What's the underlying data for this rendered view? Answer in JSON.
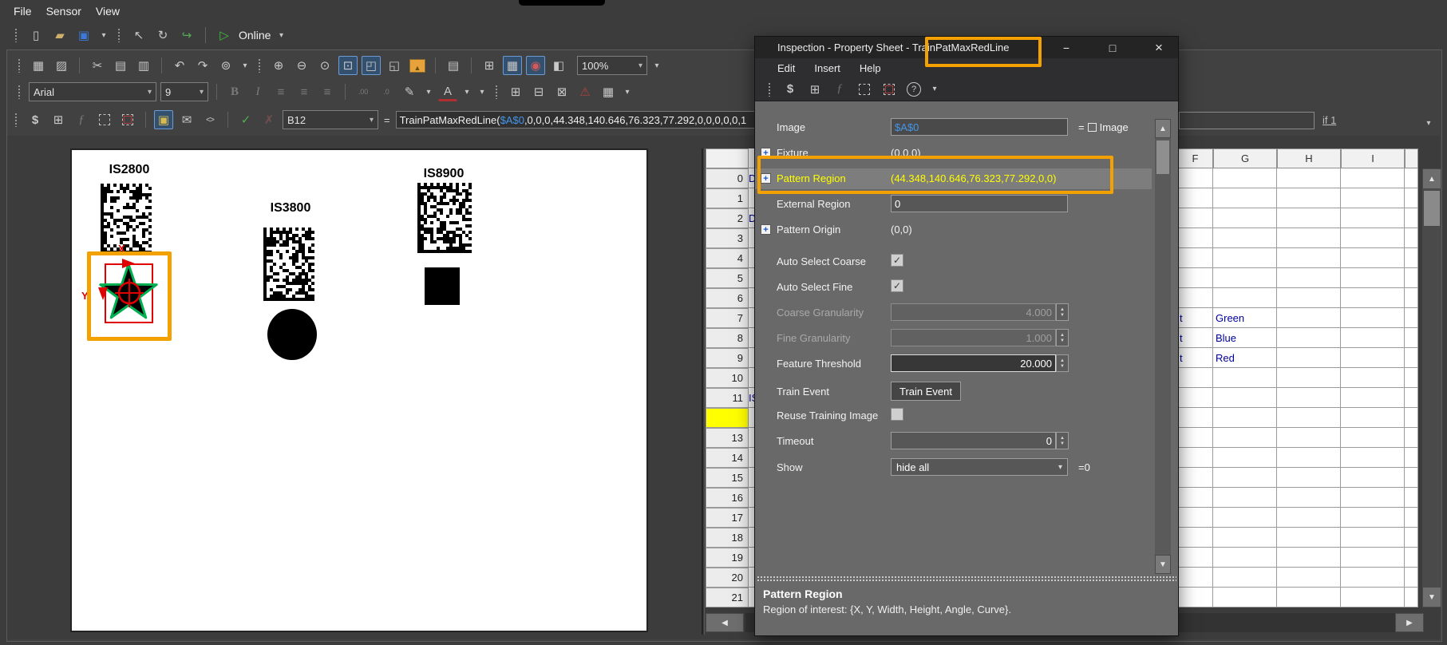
{
  "window": {
    "menu": [
      "File",
      "Sensor",
      "View"
    ],
    "online_label": "Online",
    "zoom_level": "100%",
    "font_name": "Arial",
    "font_size": "9"
  },
  "icons": {
    "newfile": "▯",
    "open": "▰",
    "save": "▣",
    "pointer": "↖",
    "refresh": "↻",
    "export": "↪",
    "online_play": "▷",
    "drop": "▾",
    "pic1": "▦",
    "pic2": "▨",
    "cut": "✂",
    "copy": "▤",
    "paste": "▥",
    "undo": "↶",
    "redo": "↷",
    "find": "⊚",
    "zoomin": "⊕",
    "zoomout": "⊖",
    "zoom1": "⊙",
    "zoomsel": "⊡",
    "fit": "◰",
    "move": "◱",
    "palette": "▤",
    "grid1": "⊞",
    "grid2": "▦",
    "overlay": "◉",
    "snippet": "◧",
    "bold": "B",
    "italic": "I",
    "align": "≡",
    "dec0": ".00",
    "dec1": ".0",
    "fill": "✎",
    "fontcolor": "A",
    "ins1": "⊞",
    "ins2": "⊟",
    "ins3": "⊠",
    "warning": "⚠",
    "borders": "▦",
    "dollar": "$",
    "fx": "ƒ",
    "comment": "✉",
    "coderef": "<>",
    "accept": "✓",
    "cancel": "✗",
    "help": "?",
    "mountain": "▲",
    "arrow_up": "▲",
    "arrow_down": "▼",
    "arrow_left": "◀",
    "arrow_right": "▶",
    "minimize": "−",
    "maximize": "□",
    "close": "×"
  },
  "formula_bar": {
    "cell_ref": "B12",
    "equals": "=",
    "formula_prefix": "TrainPatMaxRedLine(",
    "formula_ref": "$A$0",
    "formula_rest": ",0,0,0,44.348,140.646,76.323,77.292,0,0,0,0,0,1",
    "condition_label": "if 1"
  },
  "image_view": {
    "labels": [
      "IS2800",
      "IS3800",
      "IS8900"
    ],
    "axis_x_label": "X",
    "axis_y_label": "Y"
  },
  "spreadsheet": {
    "row_count": 22,
    "selected_row": 12,
    "right_columns": [
      "F",
      "G",
      "H",
      "I",
      ""
    ],
    "cells_right": [
      {
        "row": 7,
        "f": "t",
        "g": "Green"
      },
      {
        "row": 8,
        "f": "t",
        "g": "Blue"
      },
      {
        "row": 9,
        "f": "t",
        "g": "Red"
      }
    ],
    "cells_left": [
      {
        "row": 0,
        "text": "D"
      },
      {
        "row": 2,
        "text": "D"
      },
      {
        "row": 11,
        "text": "IS"
      }
    ]
  },
  "dialog": {
    "title_prefix": "Inspection - Property Sheet - ",
    "title_highlight": "TrainPatMaxRedLine",
    "menu": [
      "Edit",
      "Insert",
      "Help"
    ],
    "rows": [
      {
        "label": "Image",
        "type": "input",
        "value": "$A$0",
        "ref": true,
        "suffix_text": "Image",
        "suffix_icon": true
      },
      {
        "label": "Fixture",
        "type": "text",
        "value": "(0,0,0)",
        "expand": true
      },
      {
        "label": "Pattern Region",
        "type": "text",
        "value": "(44.348,140.646,76.323,77.292,0,0)",
        "expand": true,
        "selected": true
      },
      {
        "label": "External Region",
        "type": "input",
        "value": "0"
      },
      {
        "label": "Pattern Origin",
        "type": "text",
        "value": "(0,0)",
        "expand": true
      },
      {
        "label": "Auto Select Coarse",
        "type": "checkbox",
        "checked": true
      },
      {
        "label": "Auto Select Fine",
        "type": "checkbox",
        "checked": true
      },
      {
        "label": "Coarse Granularity",
        "type": "spin",
        "value": "4.000",
        "disabled": true
      },
      {
        "label": "Fine Granularity",
        "type": "spin",
        "value": "1.000",
        "disabled": true
      },
      {
        "label": "Feature Threshold",
        "type": "spin",
        "value": "20.000",
        "active": true
      },
      {
        "label": "Train Event",
        "type": "button",
        "value": "Train Event"
      },
      {
        "label": "Reuse Training Image",
        "type": "checkbox",
        "checked": false
      },
      {
        "label": "Timeout",
        "type": "spin",
        "value": "0"
      },
      {
        "label": "Show",
        "type": "select",
        "value": "hide all",
        "suffix_text": "0"
      }
    ],
    "description_title": "Pattern Region",
    "description_text": "Region of interest: {X, Y, Width, Height, Angle, Curve}."
  },
  "colors": {
    "annotation_orange": "#f2a100",
    "selection_yellow": "#ffff00",
    "reference_blue": "#4596e8",
    "cell_text_navy": "#000099",
    "fixture_red": "#e00000",
    "star_green": "#00b050"
  }
}
